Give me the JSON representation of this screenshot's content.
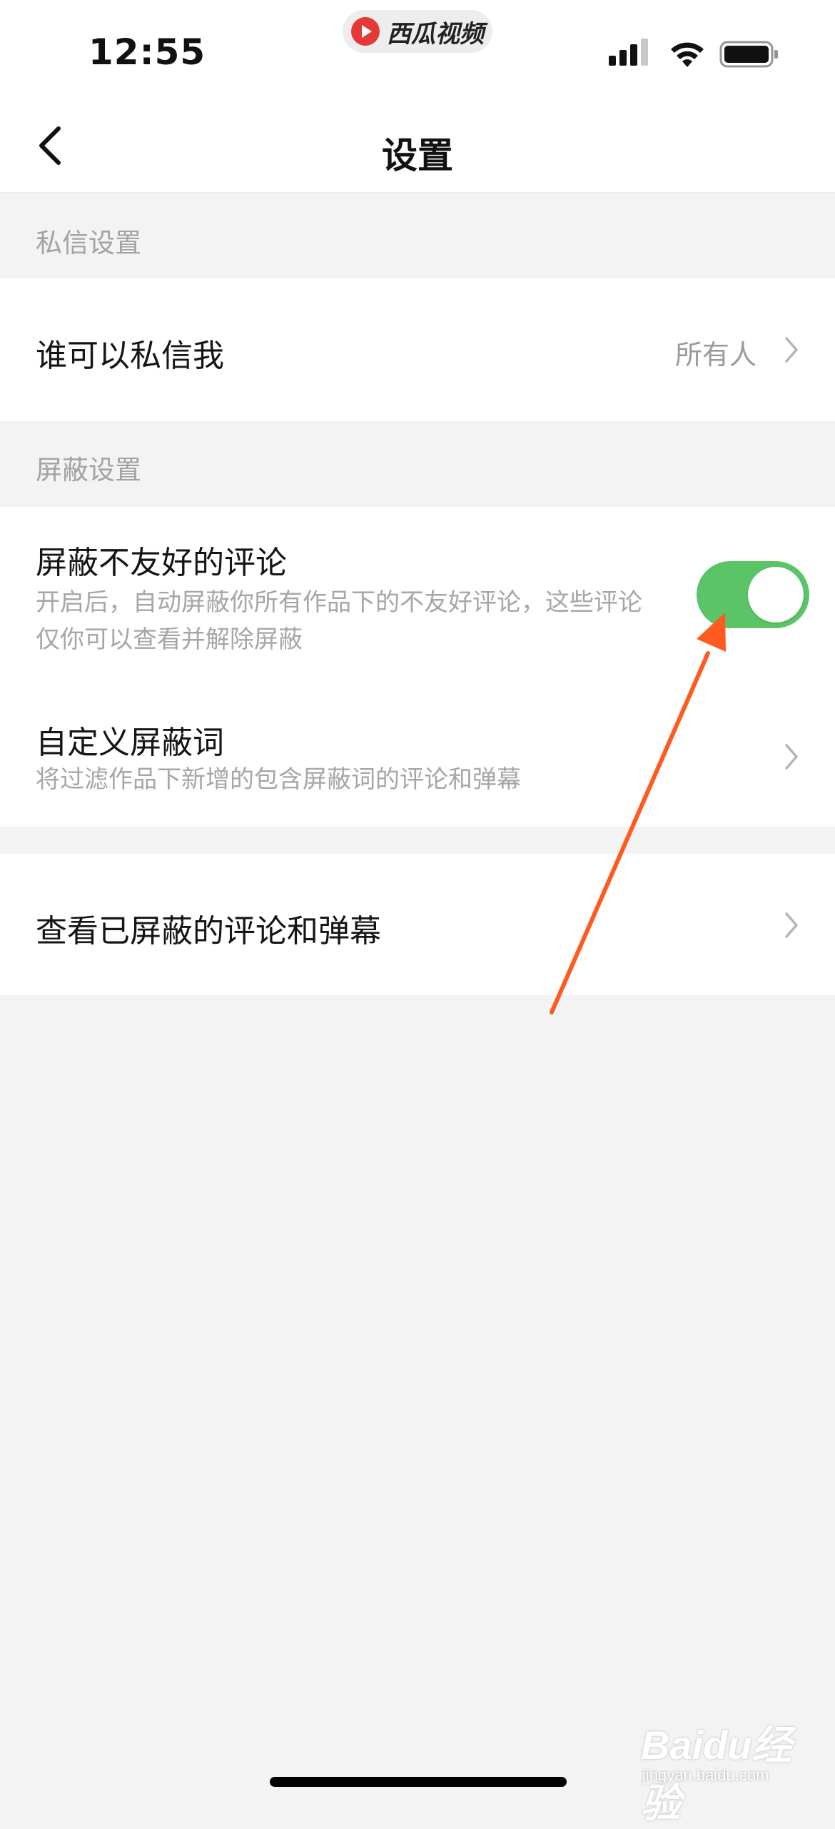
{
  "status_bar": {
    "time": "12:55",
    "app_pill_label": "西瓜视频",
    "app_icon": "play-logo-icon",
    "icons": [
      "signal-icon",
      "wifi-icon",
      "battery-icon"
    ]
  },
  "nav": {
    "title": "设置",
    "back_icon": "chevron-left-icon"
  },
  "sections": {
    "dm_header": "私信设置",
    "dm_row": {
      "title": "谁可以私信我",
      "value": "所有人"
    },
    "block_header": "屏蔽设置",
    "unfriendly_row": {
      "title": "屏蔽不友好的评论",
      "desc": "开启后，自动屏蔽你所有作品下的不友好评论，这些评论仅你可以查看并解除屏蔽",
      "toggle_on": true
    },
    "custom_words_row": {
      "title": "自定义屏蔽词",
      "desc": "将过滤作品下新增的包含屏蔽词的评论和弹幕"
    },
    "view_blocked_row": {
      "title": "查看已屏蔽的评论和弹幕"
    }
  },
  "watermark": {
    "logo": "Baidu经验",
    "url": "jingyan.baidu.com"
  },
  "colors": {
    "toggle_on": "#5ac467",
    "annotation_arrow": "#ff5a1f",
    "background": "#f3f3f3",
    "secondary_text": "#a6a6a6"
  }
}
